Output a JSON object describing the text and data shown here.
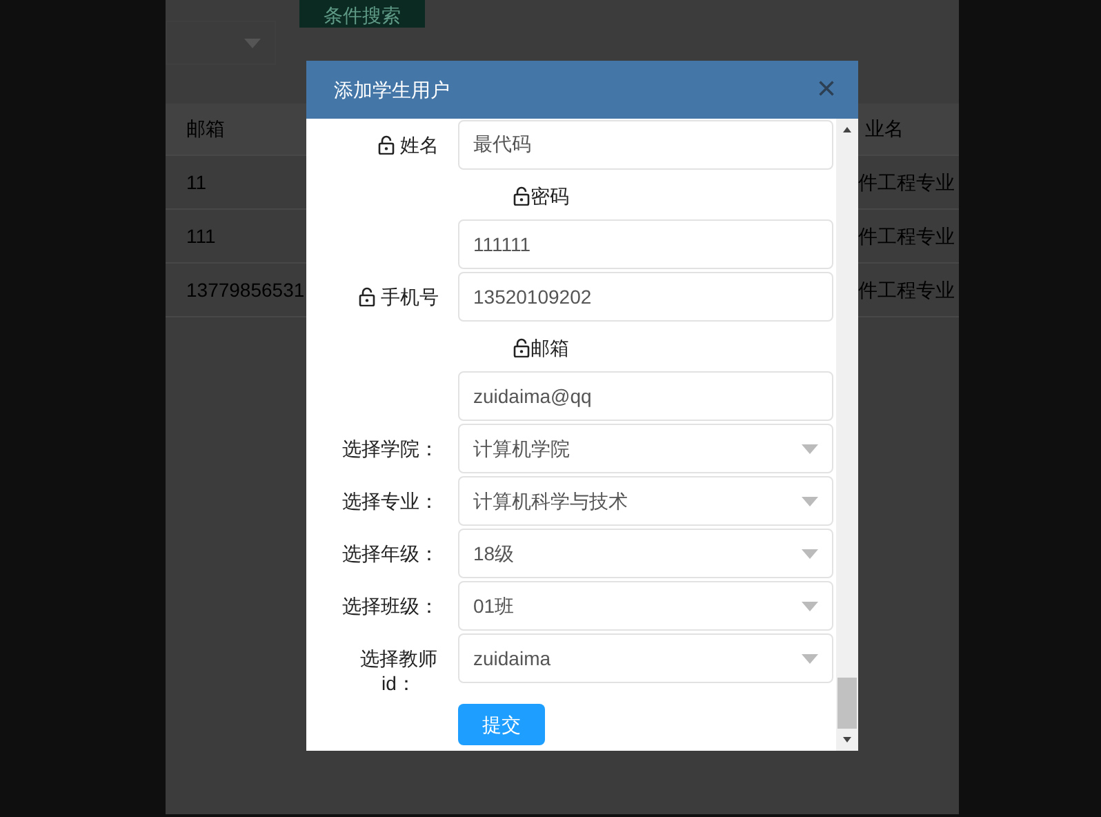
{
  "background": {
    "search_button": "条件搜索",
    "table": {
      "columns": [
        "邮箱",
        "业名"
      ],
      "rows": [
        [
          "11",
          "件工程专业"
        ],
        [
          "111",
          "件工程专业"
        ],
        [
          "13779856531",
          "件工程专业"
        ]
      ]
    }
  },
  "dialog": {
    "title": "添加学生用户",
    "close": "×",
    "fields": [
      {
        "kind": "inline",
        "label": "姓名",
        "value": "最代码"
      },
      {
        "kind": "stacked",
        "label": "密码",
        "value": "111111"
      },
      {
        "kind": "inline",
        "label": "手机号",
        "value": "13520109202"
      },
      {
        "kind": "stacked",
        "label": "邮箱",
        "value": "zuidaima@qq"
      },
      {
        "kind": "select",
        "label": "选择学院：",
        "value": "计算机学院"
      },
      {
        "kind": "select",
        "label": "选择专业：",
        "value": "计算机科学与技术"
      },
      {
        "kind": "select",
        "label": "选择年级：",
        "value": "18级"
      },
      {
        "kind": "select",
        "label": "选择班级：",
        "value": "01班"
      },
      {
        "kind": "select",
        "label": "选择教师id：",
        "value": "zuidaima"
      }
    ],
    "submit": "提交"
  }
}
